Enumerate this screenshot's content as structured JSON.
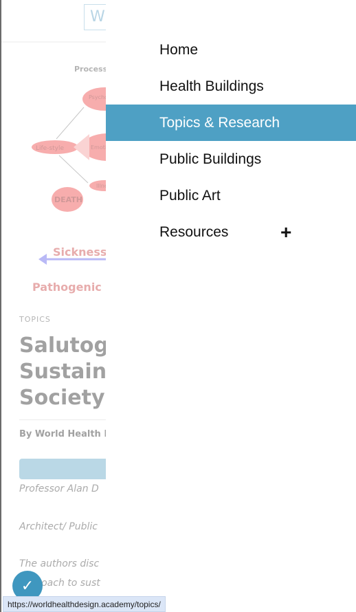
{
  "page": {
    "logo_text": "W",
    "diagram": {
      "title": "Process",
      "nodes": [
        "Psychological Factors",
        "Life-style",
        "Emotions & Expectations",
        "Illness",
        "DEATH"
      ],
      "sickness": "Sickness",
      "pathogenic": "Pathogenic"
    },
    "category": "TOPICS",
    "title": "Salutogenic Sustainable Society A",
    "byline": "By World Health D",
    "paragraphs": [
      "Professor Alan D",
      "Architect/ Public",
      "The authors disc",
      "approach to sust"
    ]
  },
  "menu": {
    "items": [
      {
        "label": "Home"
      },
      {
        "label": "Health Buildings"
      },
      {
        "label": "Topics & Research",
        "active": true
      },
      {
        "label": "Public Buildings"
      },
      {
        "label": "Public Art"
      },
      {
        "label": "Resources",
        "expand": "+"
      }
    ],
    "active_color": "#4ea0c4"
  },
  "status_url": "https://worldhealthdesign.academy/topics/",
  "badge_icon": "accessibility-check-icon"
}
